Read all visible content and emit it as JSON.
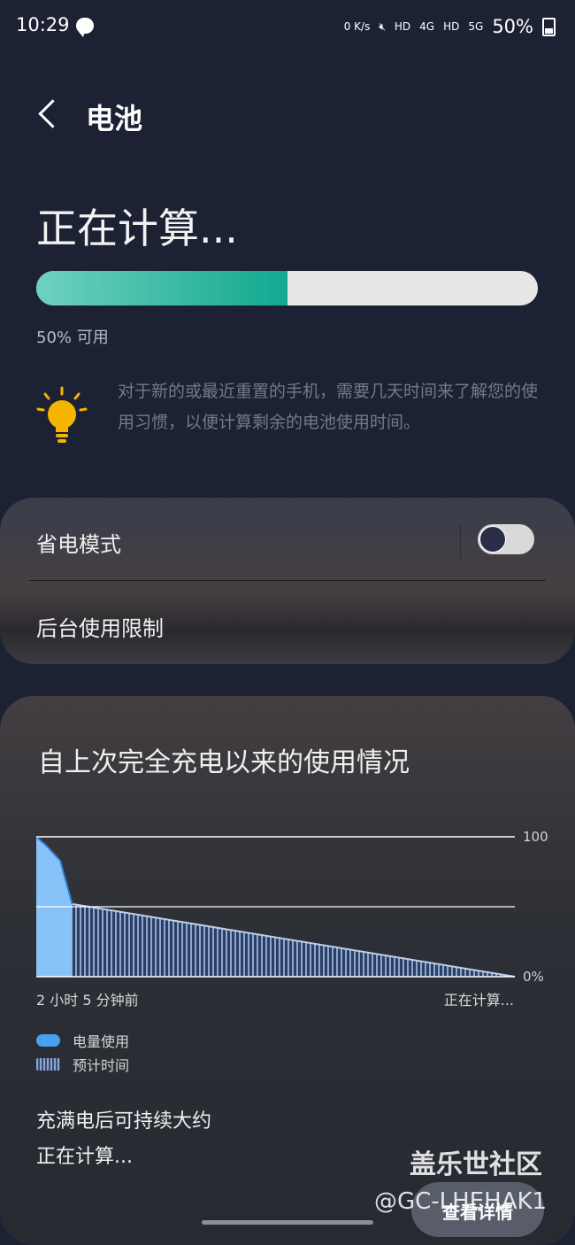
{
  "status_bar": {
    "time": "10:29",
    "net_speed": "0 K/s",
    "hd1": "HD",
    "net1": "4G",
    "hd2": "HD",
    "net2": "5G",
    "battery": "50%"
  },
  "header": {
    "title": "电池"
  },
  "summary": {
    "headline": "正在计算...",
    "battery_level_percent": 50,
    "available_label": "50% 可用",
    "tip": "对于新的或最近重置的手机，需要几天时间来了解您的使用习惯，以便计算剩余的电池使用时间。"
  },
  "settings": {
    "power_saving": {
      "label": "省电模式",
      "enabled": false
    },
    "background_limit": {
      "label": "后台使用限制"
    }
  },
  "usage": {
    "title": "自上次完全充电以来的使用情况",
    "x_start": "2 小时 5 分钟前",
    "x_end": "正在计算...",
    "legend": {
      "used": "电量使用",
      "estimated": "预计时间"
    },
    "lasts_label": "充满电后可持续大约",
    "lasts_value": "正在计算..."
  },
  "chart_data": {
    "type": "area",
    "y_ticks": [
      "100",
      "0%"
    ],
    "ylim": [
      0,
      100
    ],
    "x_labels": [
      "2 小时 5 分钟前",
      "正在计算..."
    ],
    "series": [
      {
        "name": "电量使用",
        "points": [
          [
            0,
            100
          ],
          [
            0.02,
            94
          ],
          [
            0.05,
            83
          ],
          [
            0.075,
            52
          ]
        ],
        "color": "#4aa0f0"
      },
      {
        "name": "预计时间",
        "points": [
          [
            0.075,
            52
          ],
          [
            1.0,
            0
          ]
        ],
        "color": "#8aa8d0"
      }
    ],
    "reference_line": 50,
    "grid": true,
    "legend_position": "bottom-left"
  },
  "overlay": {
    "watermark": "盖乐世社区",
    "handle": "@GC-LHEHAK1",
    "details_button": "查看详情"
  },
  "colors": {
    "accent": "#12a890",
    "used": "#4aa0f0",
    "estimated": "#8aa8d0"
  }
}
